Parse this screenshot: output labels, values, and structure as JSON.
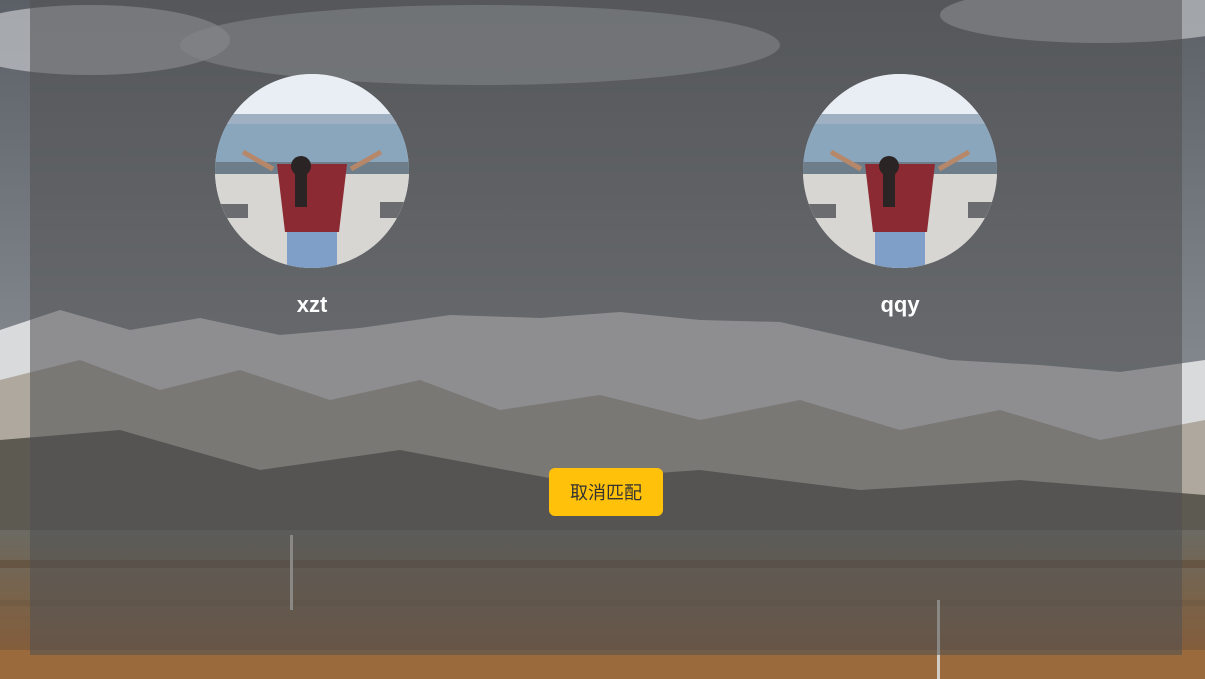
{
  "players": [
    {
      "name": "xzt"
    },
    {
      "name": "qqy"
    }
  ],
  "actions": {
    "cancel_label": "取消匹配"
  },
  "colors": {
    "button": "#ffc10a",
    "overlay": "rgba(80,80,82,0.55)"
  }
}
